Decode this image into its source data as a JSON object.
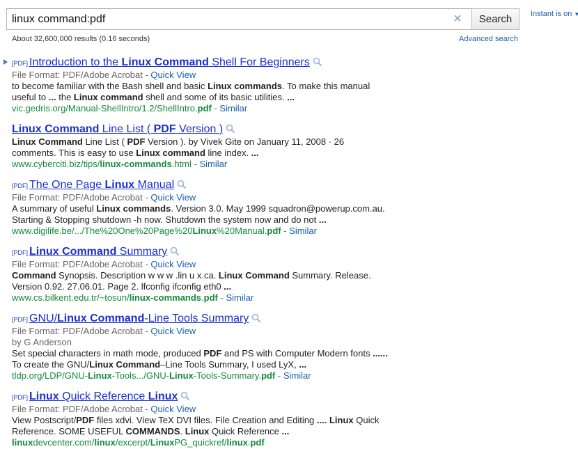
{
  "search": {
    "query": "linux command:pdf",
    "button_label": "Search",
    "clear_glyph": "×"
  },
  "instant": {
    "label": "Instant is on",
    "caret": "▼"
  },
  "stats": "About 32,600,000 results (0.16 seconds)",
  "advanced_search": "Advanced search",
  "icons": {
    "result_arrow": "arrow-right-icon",
    "preview": "magnifier-icon"
  },
  "colors": {
    "title": "#1b2fd0",
    "url": "#138a3a",
    "link": "#1a5fa8",
    "meta": "#666666"
  },
  "results": [
    {
      "pdf_tag": "[PDF]",
      "title": [
        {
          "t": "Introduction to the "
        },
        {
          "t": "Linux Command",
          "b": true
        },
        {
          "t": " Shell For Beginners"
        }
      ],
      "file_format": "File Format: PDF/Adobe Acrobat",
      "quick_view": "Quick View",
      "byline": "",
      "snippet": [
        [
          {
            "t": "to become familiar with the Bash shell and basic "
          },
          {
            "t": "Linux commands",
            "b": true
          },
          {
            "t": ". To make this manual"
          }
        ],
        [
          {
            "t": "useful to "
          },
          {
            "t": "...",
            "b": true
          },
          {
            "t": " the "
          },
          {
            "t": "Linux command",
            "b": true
          },
          {
            "t": " shell and some of its basic utilities. "
          },
          {
            "t": "...",
            "b": true
          }
        ]
      ],
      "url": [
        {
          "t": "vic.gedris.org/Manual-ShellIntro/1.2/ShellIntro."
        },
        {
          "t": "pdf",
          "b": true
        }
      ],
      "similar": "Similar"
    },
    {
      "pdf_tag": "",
      "title": [
        {
          "t": "Linux Command",
          "b": true
        },
        {
          "t": " Line List ( "
        },
        {
          "t": "PDF",
          "b": true
        },
        {
          "t": " Version )"
        }
      ],
      "file_format": "",
      "quick_view": "",
      "byline": "",
      "snippet": [
        [
          {
            "t": "Linux Command",
            "b": true
          },
          {
            "t": " Line List ( "
          },
          {
            "t": "PDF",
            "b": true
          },
          {
            "t": " Version ). by Vivek Gite on January 11, 2008 · 26"
          }
        ],
        [
          {
            "t": "comments. This is easy to use "
          },
          {
            "t": "Linux command",
            "b": true
          },
          {
            "t": " line index. "
          },
          {
            "t": "...",
            "b": true
          }
        ]
      ],
      "url": [
        {
          "t": "www.cyberciti.biz/tips/"
        },
        {
          "t": "linux-commands",
          "b": true
        },
        {
          "t": ".html"
        }
      ],
      "similar": "Similar"
    },
    {
      "pdf_tag": "[PDF]",
      "title": [
        {
          "t": "The One Page "
        },
        {
          "t": "Linux",
          "b": true
        },
        {
          "t": " Manual"
        }
      ],
      "file_format": "File Format: PDF/Adobe Acrobat",
      "quick_view": "Quick View",
      "byline": "",
      "snippet": [
        [
          {
            "t": "A summary of useful "
          },
          {
            "t": "Linux commands",
            "b": true
          },
          {
            "t": ". Version 3.0. May 1999 squadron@powerup.com.au."
          }
        ],
        [
          {
            "t": "Starting & Stopping shutdown -h now. Shutdown the system now and do not "
          },
          {
            "t": "...",
            "b": true
          }
        ]
      ],
      "url": [
        {
          "t": "www.digilife.be/.../The%20One%20Page%20"
        },
        {
          "t": "Linux",
          "b": true
        },
        {
          "t": "%20Manual."
        },
        {
          "t": "pdf",
          "b": true
        }
      ],
      "similar": "Similar"
    },
    {
      "pdf_tag": "[PDF]",
      "title": [
        {
          "t": "Linux Command",
          "b": true
        },
        {
          "t": " Summary"
        }
      ],
      "file_format": "File Format: PDF/Adobe Acrobat",
      "quick_view": "Quick View",
      "byline": "",
      "snippet": [
        [
          {
            "t": "Command",
            "b": true
          },
          {
            "t": " Synopsis. Description w w w .lin u x.ca. "
          },
          {
            "t": "Linux Command",
            "b": true
          },
          {
            "t": " Summary. Release."
          }
        ],
        [
          {
            "t": "Version 0.92. 27.06.01. Page 2. lfconfig ifconfig eth0 "
          },
          {
            "t": "...",
            "b": true
          }
        ]
      ],
      "url": [
        {
          "t": "www.cs.bilkent.edu.tr/~tosun/"
        },
        {
          "t": "linux-commands",
          "b": true
        },
        {
          "t": "."
        },
        {
          "t": "pdf",
          "b": true
        }
      ],
      "similar": "Similar"
    },
    {
      "pdf_tag": "[PDF]",
      "title": [
        {
          "t": "GNU/"
        },
        {
          "t": "Linux Command",
          "b": true
        },
        {
          "t": "-Line Tools Summary"
        }
      ],
      "file_format": "File Format: PDF/Adobe Acrobat",
      "quick_view": "Quick View",
      "byline": "by G Anderson",
      "snippet": [
        [
          {
            "t": "Set special characters in math mode, produced "
          },
          {
            "t": "PDF",
            "b": true
          },
          {
            "t": " and PS with Computer Modern fonts "
          },
          {
            "t": "......",
            "b": true
          }
        ],
        [
          {
            "t": "To create the GNU/"
          },
          {
            "t": "Linux Command",
            "b": true
          },
          {
            "t": "–Line Tools Summary, I used LyX, "
          },
          {
            "t": "...",
            "b": true
          }
        ]
      ],
      "url": [
        {
          "t": "tldp.org/LDP/GNU-"
        },
        {
          "t": "Linux",
          "b": true
        },
        {
          "t": "-Tools.../GNU-"
        },
        {
          "t": "Linux",
          "b": true
        },
        {
          "t": "-Tools-Summary."
        },
        {
          "t": "pdf",
          "b": true
        }
      ],
      "similar": "Similar"
    },
    {
      "pdf_tag": "[PDF]",
      "title": [
        {
          "t": "Linux",
          "b": true
        },
        {
          "t": " Quick Reference "
        },
        {
          "t": "Linux",
          "b": true
        }
      ],
      "file_format": "File Format: PDF/Adobe Acrobat",
      "quick_view": "Quick View",
      "byline": "",
      "snippet": [
        [
          {
            "t": "View Postscript/"
          },
          {
            "t": "PDF",
            "b": true
          },
          {
            "t": " files xdvi. View TeX DVI files. File Creation and Editing "
          },
          {
            "t": "....",
            "b": true
          },
          {
            "t": " "
          },
          {
            "t": "Linux",
            "b": true
          },
          {
            "t": " Quick"
          }
        ],
        [
          {
            "t": "Reference. SOME USEFUL "
          },
          {
            "t": "COMMANDS",
            "b": true
          },
          {
            "t": ". "
          },
          {
            "t": "Linux",
            "b": true
          },
          {
            "t": " Quick Reference "
          },
          {
            "t": "...",
            "b": true
          }
        ]
      ],
      "url": [
        {
          "t": "linux",
          "b": true
        },
        {
          "t": "devcenter.com/"
        },
        {
          "t": "linux",
          "b": true
        },
        {
          "t": "/excerpt/"
        },
        {
          "t": "Linux",
          "b": true
        },
        {
          "t": "PG_quickref/"
        },
        {
          "t": "linux",
          "b": true
        },
        {
          "t": "."
        },
        {
          "t": "pdf",
          "b": true
        }
      ],
      "similar": ""
    }
  ]
}
